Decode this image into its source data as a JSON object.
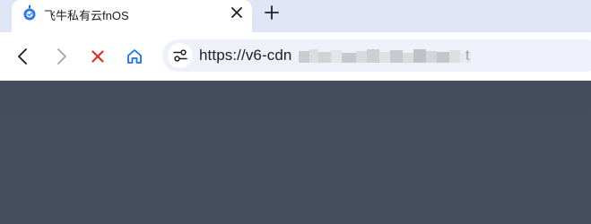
{
  "tab": {
    "title": "飞牛私有云fnOS",
    "favicon": "fnos-logo-icon",
    "close_icon": "close-icon"
  },
  "new_tab_icon": "plus-icon",
  "toolbar": {
    "back_icon": "back-arrow-icon",
    "forward_icon": "forward-arrow-icon",
    "stop_icon": "stop-x-icon",
    "home_icon": "home-icon",
    "site_info_icon": "site-settings-icon"
  },
  "omnibox": {
    "url_visible": "https://v6-cdn",
    "url_trailing_char": "t"
  },
  "colors": {
    "tabstrip_bg": "#dfe5f5",
    "toolbar_bg": "#ffffff",
    "omnibox_bg": "#eef1f9",
    "stop_icon": "#d93025",
    "home_icon": "#1a73e8",
    "content_bg": "#464f5d"
  }
}
